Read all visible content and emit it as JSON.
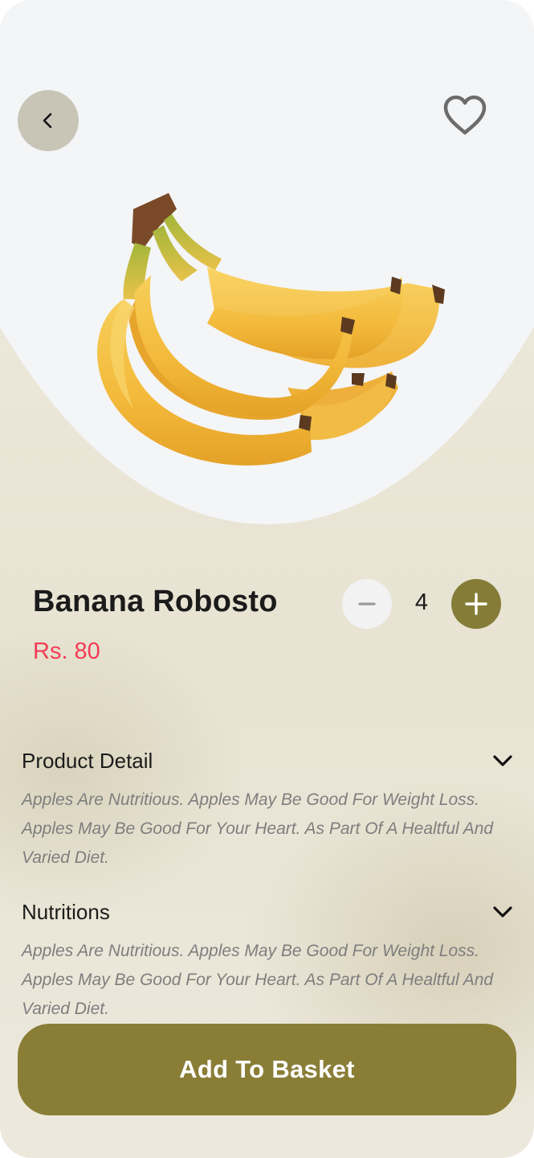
{
  "header": {
    "back_icon": "chevron-left-icon",
    "favorite_icon": "heart-outline-icon"
  },
  "product": {
    "image": "banana-bunch-image",
    "name": "Banana Robosto",
    "price": "Rs. 80"
  },
  "quantity": {
    "value": "4",
    "decrement_icon": "minus-icon",
    "increment_icon": "plus-icon"
  },
  "sections": [
    {
      "title": "Product Detail",
      "body": "Apples Are Nutritious. Apples May Be Good For Weight Loss. Apples May Be Good For Your Heart. As Part Of A Healtful And Varied Diet.",
      "icon": "chevron-down-icon"
    },
    {
      "title": "Nutritions",
      "body": "Apples Are Nutritious. Apples May Be Good For Weight Loss. Apples May Be Good For Your Heart. As Part Of A Healtful And Varied Diet.",
      "icon": "chevron-down-icon"
    }
  ],
  "cta": {
    "label": "Add To Basket"
  },
  "colors": {
    "accent": "#857c37",
    "price": "#f43b55",
    "back_button": "#c8c5b7",
    "hero_background": "#f4f5f7"
  }
}
